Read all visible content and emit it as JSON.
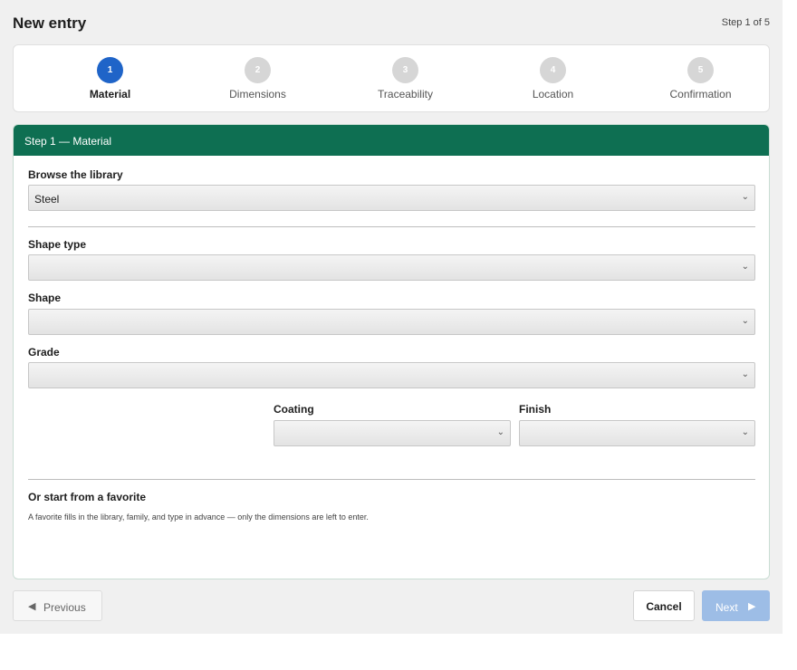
{
  "header": {
    "title": "New entry",
    "step_count": "Step 1 of 5"
  },
  "stepper": {
    "steps": [
      {
        "number": "1",
        "label": "Material",
        "active": true
      },
      {
        "number": "2",
        "label": "Dimensions",
        "active": false
      },
      {
        "number": "3",
        "label": "Traceability",
        "active": false
      },
      {
        "number": "4",
        "label": "Location",
        "active": false
      },
      {
        "number": "5",
        "label": "Confirmation",
        "active": false
      }
    ]
  },
  "panel": {
    "title": "Step 1 — Material",
    "library": {
      "label": "Browse the library",
      "value": "Steel"
    },
    "shape_type": {
      "label": "Shape type",
      "value": ""
    },
    "shape": {
      "label": "Shape",
      "value": ""
    },
    "grade": {
      "label": "Grade",
      "value": ""
    },
    "coating": {
      "label": "Coating",
      "value": ""
    },
    "finish": {
      "label": "Finish",
      "value": ""
    },
    "favorite": {
      "title": "Or start from a favorite",
      "description": "A favorite fills in the library, family, and type in advance — only the dimensions are left to enter."
    }
  },
  "footer": {
    "previous_label": "Previous",
    "cancel_label": "Cancel",
    "next_label": "Next"
  },
  "icons": {
    "chevron": "chevron-down-icon",
    "previous": "triangle-left-icon",
    "next": "triangle-right-icon"
  },
  "colors": {
    "panel_header": "#0e6f52",
    "active_step": "#1f64c8",
    "inactive_step": "#d6d6d6",
    "next_button": "#9dbde6"
  }
}
